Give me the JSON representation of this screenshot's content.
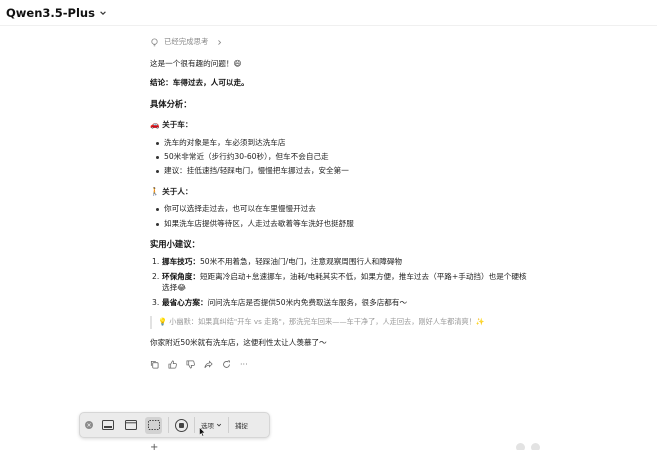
{
  "header": {
    "model_name": "Qwen3.5-Plus"
  },
  "thinking": {
    "label": "已经完成思考"
  },
  "answer": {
    "intro": "这是一个很有趣的问题！😄",
    "conclusion": "结论：车得过去，人可以走。",
    "analysis_heading": "具体分析：",
    "car_section": {
      "title": "🚗 关于车：",
      "items": [
        "洗车的对象是车，车必须到达洗车店",
        "50米非常近（步行约30-60秒），但车不会自己走",
        "建议：挂低速挡/轻踩电门，慢慢把车挪过去，安全第一"
      ]
    },
    "person_section": {
      "title": "🚶 关于人：",
      "items": [
        "你可以选择走过去，也可以在车里慢慢开过去",
        "如果洗车店提供等待区，人走过去歇着等车洗好也挺舒服"
      ]
    },
    "tips_heading": "实用小建议：",
    "tips": [
      {
        "num": "1.",
        "bold": "挪车技巧：",
        "text": "50米不用着急，轻踩油门/电门，注意观察周围行人和障碍物"
      },
      {
        "num": "2.",
        "bold": "环保角度：",
        "text": "短距离冷启动+怠速挪车，油耗/电耗其实不低，如果方便，推车过去（平路+手动挡）也是个硬核选择😂"
      },
      {
        "num": "3.",
        "bold": "最省心方案：",
        "text": "问问洗车店是否提供50米内免费取送车服务，很多店都有～"
      }
    ],
    "tip_quote": "💡 小幽默：如果真纠结\"开车 vs 走路\"，那洗完车回来——车干净了，人走回去，刚好人车都清爽！✨",
    "closing": "你家附近50米就有洗车店，这便利性太让人羡慕了～"
  },
  "action_icons": [
    "copy-icon",
    "thumbs-up-icon",
    "thumbs-down-icon",
    "share-icon",
    "regenerate-icon",
    "more-icon"
  ],
  "more_label": "···",
  "capture_toolbar": {
    "options_label": "选项",
    "capture_label": "捕捉"
  }
}
